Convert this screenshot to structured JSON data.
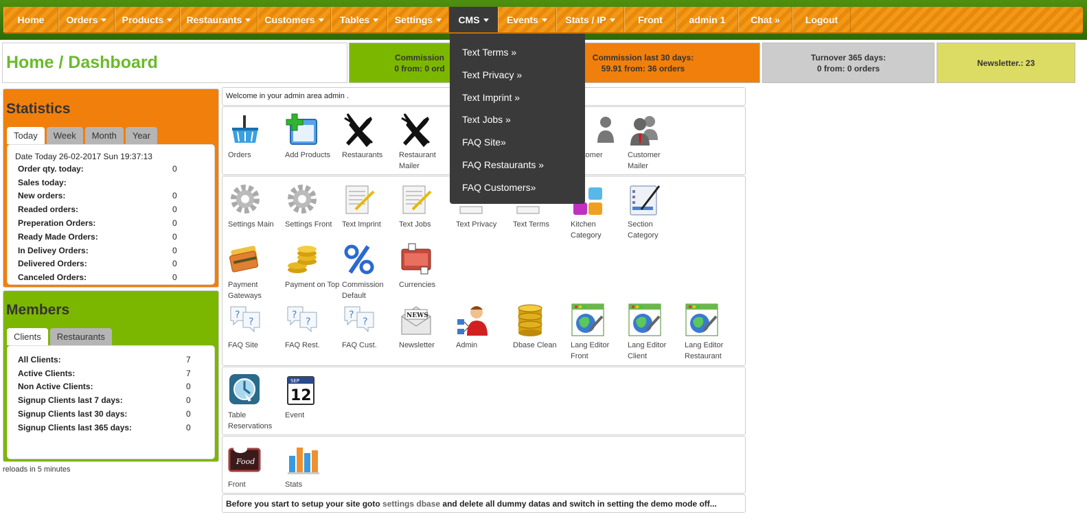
{
  "nav": {
    "home": "Home",
    "orders": "Orders",
    "products": "Products",
    "restaurants": "Restaurants",
    "customers": "Customers",
    "tables": "Tables",
    "settings": "Settings",
    "cms": "CMS",
    "events": "Events",
    "stats": "Stats / IP",
    "front": "Front",
    "admin": "admin 1",
    "chat": "Chat »",
    "logout": "Logout"
  },
  "cms_menu": {
    "text_terms": "Text Terms »",
    "text_privacy": "Text Privacy »",
    "text_imprint": "Text Imprint »",
    "text_jobs": "Text Jobs »",
    "faq_site": "FAQ Site»",
    "faq_restaurants": "FAQ Restaurants »",
    "faq_customers": "FAQ Customers»"
  },
  "header": {
    "title": "Home / Dashboard",
    "commission_today_line1": "Commission",
    "commission_today_line2": "0 from: 0 ord",
    "commission30_line1": "Commission last 30 days:",
    "commission30_line2": "59.91 from: 36 orders",
    "turnover_line1": "Turnover 365 days:",
    "turnover_line2": "0 from: 0 orders",
    "newsletter": "Newsletter.: 23"
  },
  "colors": {
    "green": "#7cb700",
    "orange": "#f07f0c",
    "grey": "#cccccc",
    "yellow": "#dcdc64",
    "menu_dark": "#3a3a3a"
  },
  "statistics": {
    "title": "Statistics",
    "tabs": [
      "Today",
      "Week",
      "Month",
      "Year"
    ],
    "date": "Date Today 26-02-2017 Sun 19:37:13",
    "rows": [
      {
        "label": "Order qty. today:",
        "value": "0"
      },
      {
        "label": "Sales today:",
        "value": ""
      },
      {
        "label": "New orders:",
        "value": "0"
      },
      {
        "label": "Readed orders:",
        "value": "0"
      },
      {
        "label": "Preperation Orders:",
        "value": "0"
      },
      {
        "label": "Ready Made Orders:",
        "value": "0"
      },
      {
        "label": "In Delivey Orders:",
        "value": "0"
      },
      {
        "label": "Delivered Orders:",
        "value": "0"
      },
      {
        "label": "Canceled Orders:",
        "value": "0"
      }
    ]
  },
  "members": {
    "title": "Members",
    "tabs": [
      "Clients",
      "Restaurants"
    ],
    "rows": [
      {
        "label": "All Clients:",
        "value": "7"
      },
      {
        "label": "Active Clients:",
        "value": "7"
      },
      {
        "label": "Non Active Clients:",
        "value": "0"
      },
      {
        "label": "Signup Clients last 7 days:",
        "value": "0"
      },
      {
        "label": "Signup Clients last 30 days:",
        "value": "0"
      },
      {
        "label": "Signup Clients last 365 days:",
        "value": "0"
      }
    ]
  },
  "reload_text": "reloads in 5 minutes",
  "welcome": "Welcome in your admin area admin .",
  "tiles": {
    "orders": "Orders",
    "add_products": "Add Products",
    "restaurants": "Restaurants",
    "restaurant_mailer": "Restaurant Mailer",
    "customer": "stomer",
    "customer_mailer": "Customer Mailer",
    "settings_main": "Settings Main",
    "settings_front": "Settings Front",
    "text_imprint": "Text Imprint",
    "text_jobs": "Text Jobs",
    "text_privacy": "Text Privacy",
    "text_terms": "Text Terms",
    "kitchen_category": "Kitchen Category",
    "section_category": "Section Category",
    "payment_gateways": "Payment Gateways",
    "payment_on_top": "Payment on Top",
    "commission_default": "Commission Default",
    "currencies": "Currencies",
    "faq_site": "FAQ Site",
    "faq_rest": "FAQ Rest.",
    "faq_cust": "FAQ Cust.",
    "newsletter": "Newsletter",
    "admin": "Admin",
    "dbase_clean": "Dbase Clean",
    "lang_front": "Lang Editor Front",
    "lang_client": "Lang Editor Client",
    "lang_restaurant": "Lang Editor Restaurant",
    "table_reservations": "Table Reservations",
    "event": "Event",
    "front": "Front",
    "stats": "Stats",
    "news_label": "NEWS",
    "cal_month": "SEP",
    "cal_day": "12",
    "food_label": "Food"
  },
  "footer": {
    "before": "Before you start to setup your site goto ",
    "link": "settings dbase",
    "after": " and delete all dummy datas and switch in setting the demo mode off..."
  }
}
